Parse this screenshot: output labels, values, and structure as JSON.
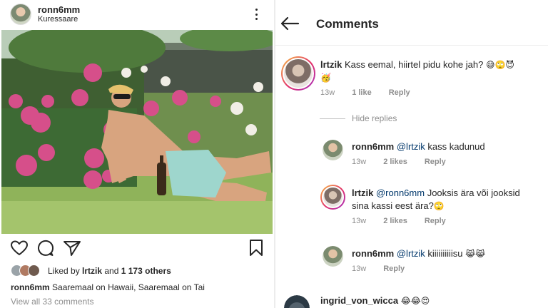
{
  "post": {
    "username": "ronn6mm",
    "location": "Kuressaare",
    "liked_by_prefix": "Liked by ",
    "liked_by_user": "lrtzik",
    "liked_by_and": " and ",
    "liked_by_others": "1 173 others",
    "caption_user": "ronn6mm",
    "caption_text": " Saaremaal on Hawaii, Saaremaal on Tai",
    "view_all": "View all 33 comments"
  },
  "comments_screen": {
    "title": "Comments",
    "hide_replies": "Hide replies",
    "comments": [
      {
        "user": "lrtzik",
        "text_line1": " Kass eemal, hiirtel pidu kohe jah? ",
        "emoji1": "😅🙄😈",
        "emoji2": "🥳",
        "age": "13w",
        "likes": "1 like",
        "reply": "Reply"
      },
      {
        "user": "ronn6mm",
        "mention": "@lrtzik",
        "text": " kass kadunud",
        "age": "13w",
        "likes": "2 likes",
        "reply": "Reply"
      },
      {
        "user": "lrtzik",
        "mention": "@ronn6mm",
        "text_line1": " Jooksis ära või jooksid",
        "text_line2": "sina kassi eest ära?",
        "emoji": "🙄",
        "age": "13w",
        "likes": "2 likes",
        "reply": "Reply"
      },
      {
        "user": "ronn6mm",
        "mention": "@lrtzik",
        "text": " kiiiiiiiiiisu ",
        "emoji": "😹😹",
        "age": "13w",
        "reply": "Reply"
      },
      {
        "user": "ingrid_von_wicca",
        "text": " ",
        "emoji": "😂😂😍"
      }
    ]
  },
  "icons": {
    "more": "more-vertical-icon",
    "like": "heart-icon",
    "comment": "comment-icon",
    "share": "send-icon",
    "save": "bookmark-icon",
    "back": "back-arrow-icon"
  },
  "colors": {
    "text": "#262626",
    "secondary": "#8e8e8e",
    "mention": "#00376b",
    "story_ring_start": "#f7c044",
    "story_ring_end": "#a334c7"
  }
}
